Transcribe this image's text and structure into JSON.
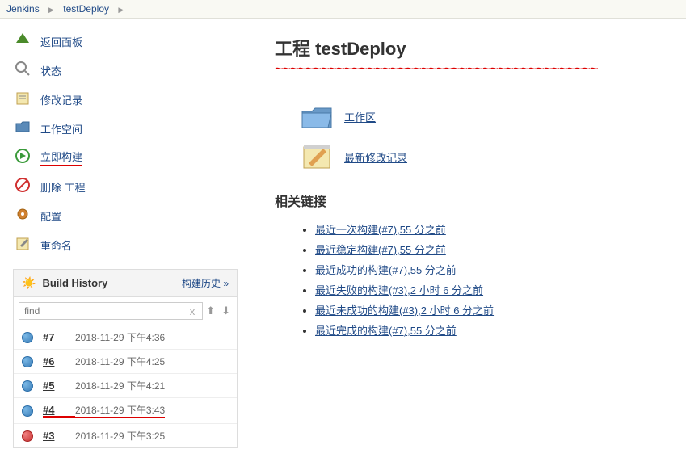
{
  "breadcrumb": {
    "home": "Jenkins",
    "project": "testDeploy"
  },
  "nav": {
    "back": "返回面板",
    "status": "状态",
    "changes": "修改记录",
    "workspace": "工作空间",
    "build_now": "立即构建",
    "delete": "删除 工程",
    "configure": "配置",
    "rename": "重命名"
  },
  "history": {
    "title": "Build History",
    "link": "构建历史",
    "find_placeholder": "find",
    "builds": [
      {
        "num": "#7",
        "date": "2018-11-29 下午4:36",
        "status": "blue"
      },
      {
        "num": "#6",
        "date": "2018-11-29 下午4:25",
        "status": "blue"
      },
      {
        "num": "#5",
        "date": "2018-11-29 下午4:21",
        "status": "blue"
      },
      {
        "num": "#4",
        "date": "2018-11-29 下午3:43",
        "status": "blue"
      },
      {
        "num": "#3",
        "date": "2018-11-29 下午3:25",
        "status": "red"
      }
    ]
  },
  "main": {
    "title": "工程 testDeploy",
    "workspace": "工作区",
    "recent_changes": "最新修改记录",
    "related_title": "相关链接",
    "links": [
      {
        "text": "最近一次构建(#7)",
        "time": ",55 分之前"
      },
      {
        "text": "最近稳定构建(#7)",
        "time": ",55 分之前"
      },
      {
        "text": "最近成功的构建(#7)",
        "time": ",55 分之前"
      },
      {
        "text": "最近失败的构建(#3)",
        "time": ",2 小时 6 分之前"
      },
      {
        "text": "最近未成功的构建(#3)",
        "time": ",2 小时 6 分之前"
      },
      {
        "text": "最近完成的构建(#7)",
        "time": ",55 分之前"
      }
    ]
  }
}
